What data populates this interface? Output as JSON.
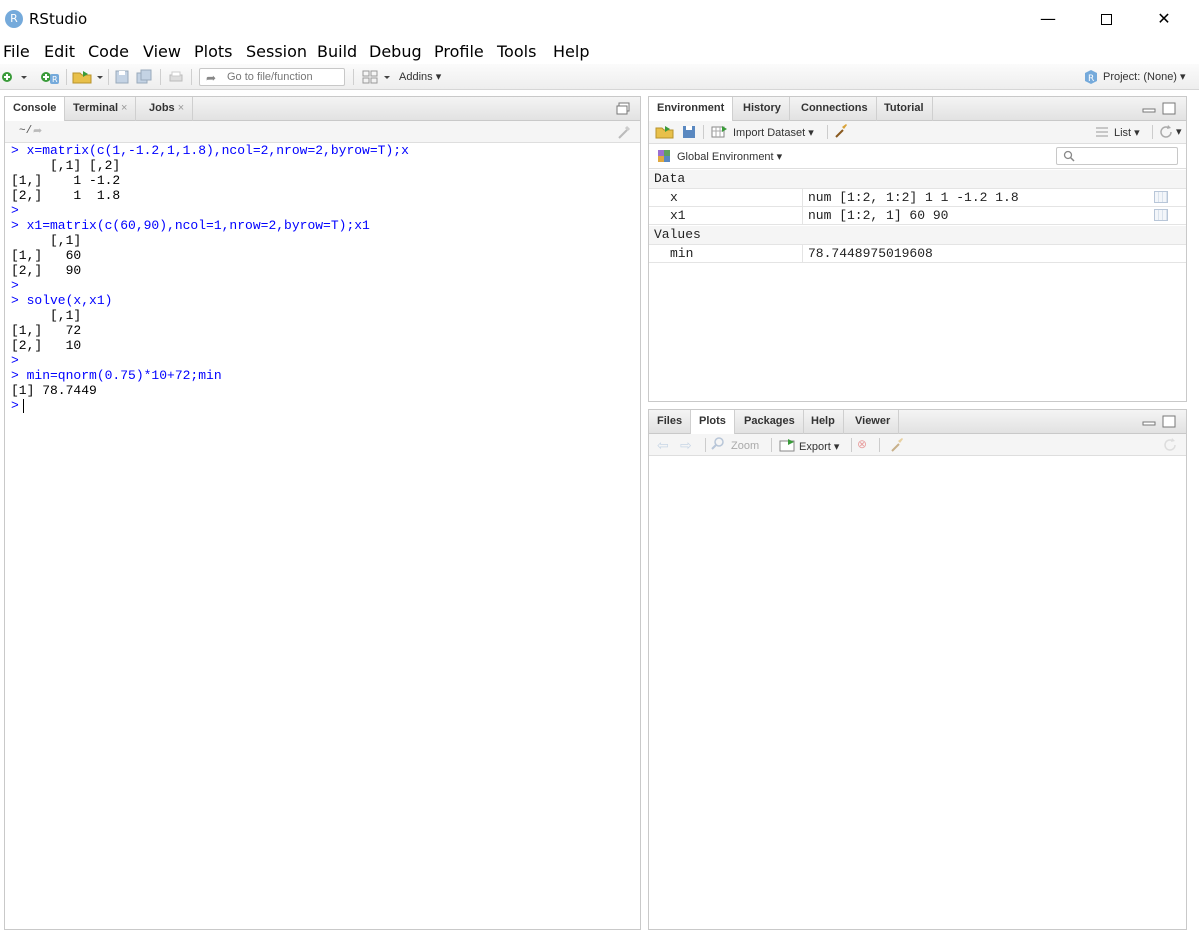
{
  "window": {
    "title": "RStudio",
    "icon_letter": "R",
    "minimize": "—",
    "close": "✕"
  },
  "menu": [
    "File",
    "Edit",
    "Code",
    "View",
    "Plots",
    "Session",
    "Build",
    "Debug",
    "Profile",
    "Tools",
    "Help"
  ],
  "toolbar": {
    "goto_placeholder": "Go to file/function",
    "addins_label": "Addins",
    "project_label": "Project: (None)"
  },
  "console_pane": {
    "tabs": [
      {
        "label": "Console",
        "active": true
      },
      {
        "label": "Terminal",
        "close": "×"
      },
      {
        "label": "Jobs",
        "close": "×"
      }
    ],
    "path": "~/",
    "lines": [
      {
        "type": "cmd",
        "text": "> x=matrix(c(1,-1.2,1,1.8),ncol=2,nrow=2,byrow=T);x"
      },
      {
        "type": "out",
        "text": "     [,1] [,2]"
      },
      {
        "type": "out",
        "text": "[1,]    1 -1.2"
      },
      {
        "type": "out",
        "text": "[2,]    1  1.8"
      },
      {
        "type": "cmd",
        "text": "> "
      },
      {
        "type": "cmd",
        "text": "> x1=matrix(c(60,90),ncol=1,nrow=2,byrow=T);x1"
      },
      {
        "type": "out",
        "text": "     [,1]"
      },
      {
        "type": "out",
        "text": "[1,]   60"
      },
      {
        "type": "out",
        "text": "[2,]   90"
      },
      {
        "type": "cmd",
        "text": "> "
      },
      {
        "type": "cmd",
        "text": "> solve(x,x1)"
      },
      {
        "type": "out",
        "text": "     [,1]"
      },
      {
        "type": "out",
        "text": "[1,]   72"
      },
      {
        "type": "out",
        "text": "[2,]   10"
      },
      {
        "type": "cmd",
        "text": "> "
      },
      {
        "type": "cmd",
        "text": "> min=qnorm(0.75)*10+72;min"
      },
      {
        "type": "out",
        "text": "[1] 78.7449"
      }
    ],
    "prompt": ">"
  },
  "env_pane": {
    "tabs": [
      {
        "label": "Environment",
        "active": true
      },
      {
        "label": "History"
      },
      {
        "label": "Connections"
      },
      {
        "label": "Tutorial"
      }
    ],
    "import_label": "Import Dataset",
    "list_label": "List",
    "scope_label": "Global Environment",
    "sections": [
      {
        "heading": "Data",
        "rows": [
          {
            "name": "x",
            "value": "num [1:2, 1:2] 1 1 -1.2 1.8",
            "grid": true
          },
          {
            "name": "x1",
            "value": "num [1:2, 1] 60 90",
            "grid": true
          }
        ]
      },
      {
        "heading": "Values",
        "rows": [
          {
            "name": "min",
            "value": "78.7448975019608",
            "grid": false
          }
        ]
      }
    ]
  },
  "files_pane": {
    "tabs": [
      {
        "label": "Files"
      },
      {
        "label": "Plots",
        "active": true
      },
      {
        "label": "Packages"
      },
      {
        "label": "Help"
      },
      {
        "label": "Viewer"
      }
    ],
    "zoom_label": "Zoom",
    "export_label": "Export"
  },
  "colors": {
    "command": "#0000ff",
    "output": "#000000",
    "accent": "#75aadb"
  }
}
